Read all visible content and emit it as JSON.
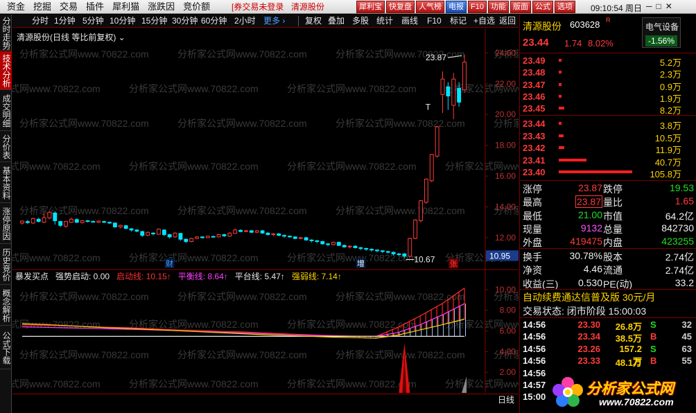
{
  "menu": {
    "items": [
      "资金",
      "挖掘",
      "交易",
      "插件",
      "犀利猫",
      "涨跌因",
      "竞价额"
    ],
    "broker_warning": "[券交易未登录",
    "stock": "清源股份",
    "buttons": [
      {
        "label": "犀利宝",
        "color": "red"
      },
      {
        "label": "快复盘",
        "color": "red"
      },
      {
        "label": "人气榜",
        "color": "red"
      },
      {
        "label": "电报",
        "color": "blue"
      },
      {
        "label": "F10",
        "color": "red"
      },
      {
        "label": "功能",
        "color": "red"
      },
      {
        "label": "版面",
        "color": "red"
      },
      {
        "label": "公式",
        "color": "red"
      },
      {
        "label": "选项",
        "color": "red"
      }
    ],
    "clock": "09:10:54 周日",
    "window_controls": [
      "─",
      "□",
      "✕"
    ]
  },
  "left_tabs": [
    {
      "label": "分时走势",
      "active": false
    },
    {
      "label": "技术分析",
      "active": true
    },
    {
      "label": "成交明细",
      "active": false
    },
    {
      "label": "分价表",
      "active": false
    },
    {
      "label": "基本资料",
      "active": false
    },
    {
      "label": "涨停原因",
      "active": false
    },
    {
      "label": "历史竞价",
      "active": false
    },
    {
      "label": "概念解析",
      "active": false
    },
    {
      "label": "公式下载",
      "active": false
    }
  ],
  "toolbar": {
    "periods": [
      "分时",
      "1分钟",
      "5分钟",
      "10分钟",
      "15分钟",
      "30分钟",
      "60分钟",
      "2小时"
    ],
    "more": "更多 ›",
    "tools": [
      "复权",
      "叠加",
      "多股",
      "统计",
      "画线",
      "F10",
      "标记",
      "+自选",
      "返回"
    ]
  },
  "chart_title": "清源股份(日线 等比前复权) ⌄",
  "watermark": "分析家公式网www.70822.com",
  "indicator_legend": {
    "name": "暴发买点",
    "items": [
      {
        "label": "强势启动: 0.00",
        "color": "#e8e8e8"
      },
      {
        "label": "启动线: 10.15↑",
        "color": "#ff3030"
      },
      {
        "label": "平衡线: 8.64↑",
        "color": "#ff40ff"
      },
      {
        "label": "平台线: 5.47↑",
        "color": "#e8e8e8"
      },
      {
        "label": "强弱线: 7.14↑",
        "color": "#ffd400"
      }
    ]
  },
  "chart_data": {
    "type": "candlestick",
    "ylim": [
      10.2,
      24.6
    ],
    "y_ticks": [
      "24.00",
      "22.00",
      "20.00",
      "18.00",
      "16.00",
      "14.00",
      "12.00"
    ],
    "current_price_label": "10.95",
    "annotations": {
      "high": "23.87",
      "low": "10.67",
      "t_mark": "T"
    },
    "event_markers": [
      {
        "label": "财",
        "index": 27
      },
      {
        "label": "增",
        "index": 62
      },
      {
        "label": "张",
        "index": 79
      }
    ],
    "candles": [
      [
        12.95,
        13.08,
        12.85,
        13.12
      ],
      [
        13.05,
        12.98,
        12.9,
        13.15
      ],
      [
        12.95,
        13.25,
        12.9,
        13.3
      ],
      [
        13.2,
        13.05,
        13.0,
        13.28
      ],
      [
        13.0,
        13.3,
        12.95,
        13.6
      ],
      [
        13.28,
        13.65,
        13.2,
        13.75
      ],
      [
        13.6,
        13.1,
        12.85,
        13.7
      ],
      [
        13.05,
        12.8,
        12.7,
        13.1
      ],
      [
        12.75,
        13.05,
        12.65,
        13.1
      ],
      [
        13.0,
        13.2,
        12.95,
        13.3
      ],
      [
        13.18,
        13.0,
        12.95,
        13.25
      ],
      [
        12.98,
        13.1,
        12.92,
        13.15
      ],
      [
        13.1,
        13.05,
        13.0,
        13.15
      ],
      [
        13.05,
        13.02,
        12.98,
        13.12
      ],
      [
        13.0,
        13.08,
        12.95,
        13.12
      ],
      [
        13.05,
        13.0,
        12.95,
        13.1
      ],
      [
        13.0,
        12.95,
        12.9,
        13.05
      ],
      [
        12.95,
        12.7,
        12.65,
        13.0
      ],
      [
        12.7,
        12.8,
        12.6,
        12.85
      ],
      [
        12.78,
        12.6,
        12.55,
        12.82
      ],
      [
        12.58,
        12.5,
        12.4,
        12.62
      ],
      [
        12.5,
        12.42,
        12.35,
        12.55
      ],
      [
        12.4,
        12.15,
        12.05,
        12.45
      ],
      [
        12.15,
        12.35,
        12.1,
        12.4
      ],
      [
        12.3,
        12.25,
        12.15,
        12.35
      ],
      [
        12.22,
        12.55,
        12.2,
        12.6
      ],
      [
        12.5,
        12.2,
        12.1,
        12.55
      ],
      [
        12.2,
        12.05,
        11.95,
        12.25
      ],
      [
        12.05,
        12.3,
        12.0,
        12.35
      ],
      [
        12.28,
        11.9,
        11.8,
        12.3
      ],
      [
        11.9,
        11.75,
        11.65,
        11.95
      ],
      [
        11.75,
        11.95,
        11.7,
        12.0
      ],
      [
        11.95,
        12.05,
        11.9,
        12.1
      ],
      [
        12.05,
        12.0,
        11.95,
        12.1
      ],
      [
        12.0,
        12.1,
        11.98,
        12.12
      ],
      [
        12.08,
        12.05,
        12.0,
        12.12
      ],
      [
        12.05,
        12.2,
        12.02,
        12.25
      ],
      [
        12.2,
        12.12,
        12.05,
        12.25
      ],
      [
        12.1,
        12.3,
        12.05,
        12.35
      ],
      [
        12.28,
        12.5,
        12.25,
        12.6
      ],
      [
        12.48,
        12.4,
        12.35,
        12.55
      ],
      [
        12.4,
        12.45,
        12.35,
        12.5
      ],
      [
        12.45,
        12.35,
        12.3,
        12.5
      ],
      [
        12.35,
        12.45,
        12.3,
        12.5
      ],
      [
        12.45,
        12.3,
        12.25,
        12.5
      ],
      [
        12.3,
        12.2,
        12.15,
        12.35
      ],
      [
        12.2,
        12.25,
        12.1,
        12.3
      ],
      [
        12.25,
        12.15,
        12.1,
        12.3
      ],
      [
        12.15,
        12.1,
        12.0,
        12.2
      ],
      [
        12.1,
        12.05,
        12.0,
        12.15
      ],
      [
        12.05,
        11.95,
        11.9,
        12.1
      ],
      [
        11.95,
        12.0,
        11.9,
        12.05
      ],
      [
        12.0,
        11.85,
        11.8,
        12.05
      ],
      [
        11.85,
        11.8,
        11.7,
        11.9
      ],
      [
        11.8,
        11.75,
        11.65,
        11.85
      ],
      [
        11.75,
        11.6,
        11.55,
        11.8
      ],
      [
        11.6,
        11.55,
        11.45,
        11.65
      ],
      [
        11.55,
        11.7,
        11.5,
        11.75
      ],
      [
        11.7,
        11.5,
        11.45,
        11.75
      ],
      [
        11.5,
        11.4,
        11.35,
        11.55
      ],
      [
        11.4,
        11.45,
        11.3,
        11.5
      ],
      [
        11.45,
        11.35,
        11.3,
        11.5
      ],
      [
        11.35,
        11.3,
        11.2,
        11.4
      ],
      [
        11.3,
        11.25,
        11.15,
        11.35
      ],
      [
        11.25,
        11.2,
        11.1,
        11.3
      ],
      [
        11.2,
        11.15,
        11.05,
        11.25
      ],
      [
        11.15,
        11.1,
        11.0,
        11.2
      ],
      [
        11.1,
        11.05,
        10.98,
        11.15
      ],
      [
        11.05,
        10.95,
        10.85,
        11.1
      ],
      [
        10.95,
        10.9,
        10.8,
        11.0
      ],
      [
        10.95,
        10.8,
        10.67,
        11.0
      ],
      [
        10.8,
        11.95,
        10.75,
        12.0
      ],
      [
        11.95,
        13.15,
        11.9,
        13.2
      ],
      [
        13.1,
        14.4,
        13.0,
        14.45
      ],
      [
        14.3,
        15.8,
        14.2,
        15.85
      ],
      [
        15.7,
        17.4,
        15.6,
        17.45
      ],
      [
        17.3,
        19.2,
        17.2,
        19.25
      ],
      [
        21.3,
        22.3,
        20.1,
        22.8
      ],
      [
        21.8,
        21.2,
        20.3,
        22.1
      ],
      [
        20.6,
        22.3,
        19.7,
        22.7
      ],
      [
        21.7,
        20.8,
        20.5,
        22.1
      ],
      [
        21.6,
        23.4,
        21.4,
        23.87
      ]
    ],
    "indicator": {
      "ylim": [
        0,
        11
      ],
      "y_ticks": [
        "10.00",
        "8.00",
        "6.00",
        "4.00",
        "2.00"
      ],
      "series": [
        {
          "name": "启动线",
          "values": [
            6.6,
            6.55,
            6.5,
            6.42,
            6.35,
            6.3,
            6.2,
            6.1,
            6.05,
            5.95,
            5.9,
            5.8,
            5.7,
            5.62,
            5.55,
            5.5,
            5.47,
            6.35,
            7.45,
            8.65,
            10.15
          ]
        },
        {
          "name": "平衡线",
          "values": [
            6.4,
            6.35,
            6.3,
            6.25,
            6.2,
            6.15,
            6.1,
            6.02,
            5.95,
            5.88,
            5.8,
            5.72,
            5.65,
            5.58,
            5.52,
            5.48,
            5.47,
            5.85,
            6.6,
            7.55,
            8.64
          ]
        },
        {
          "name": "平台线",
          "values": [
            5.47,
            5.47,
            5.47,
            5.47,
            5.47,
            5.47,
            5.47,
            5.47,
            5.47,
            5.47,
            5.47,
            5.47,
            5.47,
            5.47,
            5.47,
            5.47,
            5.47,
            5.47,
            5.47,
            5.47,
            5.47
          ]
        },
        {
          "name": "强弱线",
          "values": [
            6.7,
            6.62,
            6.52,
            6.4,
            6.3,
            6.22,
            6.12,
            6.02,
            5.92,
            5.82,
            5.72,
            5.62,
            5.55,
            5.48,
            5.4,
            5.35,
            5.3,
            5.6,
            6.1,
            6.6,
            7.14
          ]
        }
      ],
      "spike_index": 70,
      "spike_value": 4.8
    },
    "x_labels": [
      {
        "label": "2023年",
        "index": 0
      },
      {
        "label": "10",
        "index": 12
      },
      {
        "label": "11",
        "index": 33
      },
      {
        "label": "12",
        "index": 61
      },
      {
        "label": "1",
        "index": 78
      }
    ]
  },
  "period_label": "日线",
  "quote": {
    "name": "清源股份",
    "code": "603628",
    "r_mark": "R",
    "sector_name": "电气设备",
    "sector_change": "-1.56%",
    "price": "23.44",
    "change": "1.74",
    "change_pct": "8.02%",
    "asks": [
      {
        "price": "23.49",
        "volume": "5.2万",
        "ratio": 0.01
      },
      {
        "price": "23.48",
        "volume": "2.3万",
        "ratio": 0.01
      },
      {
        "price": "23.47",
        "volume": "0.9万",
        "ratio": 0.01
      },
      {
        "price": "23.46",
        "volume": "1.9万",
        "ratio": 0.01
      },
      {
        "price": "23.45",
        "volume": "8.2万",
        "ratio": 0.08
      }
    ],
    "bids": [
      {
        "price": "23.44",
        "volume": "3.8万",
        "ratio": 0.02
      },
      {
        "price": "23.43",
        "volume": "10.5万",
        "ratio": 0.07
      },
      {
        "price": "23.42",
        "volume": "11.9万",
        "ratio": 0.08
      },
      {
        "price": "23.41",
        "volume": "40.7万",
        "ratio": 0.38
      },
      {
        "price": "23.40",
        "volume": "105.8万",
        "ratio": 1.0
      }
    ],
    "stats": [
      {
        "l1": "涨停",
        "v1": "23.87",
        "c1": "red",
        "l2": "跌停",
        "v2": "19.53",
        "c2": "green"
      },
      {
        "l1": "最高",
        "v1": "23.87",
        "c1": "red boxed",
        "l2": "量比",
        "v2": "1.65",
        "c2": "red"
      },
      {
        "l1": "最低",
        "v1": "21.00",
        "c1": "green",
        "l2": "市值",
        "v2": "64.2亿",
        "c2": "white"
      },
      {
        "l1": "现量",
        "v1": "9132",
        "c1": "magenta",
        "l2": "总量",
        "v2": "842730",
        "c2": "white"
      },
      {
        "l1": "外盘",
        "v1": "419475",
        "c1": "red",
        "l2": "内盘",
        "v2": "423255",
        "c2": "green"
      },
      {
        "l1": "换手",
        "v1": "30.78%",
        "c1": "white",
        "l2": "股本",
        "v2": "2.74亿",
        "c2": "white"
      },
      {
        "l1": "净资",
        "v1": "4.46",
        "c1": "white",
        "l2": "流通",
        "v2": "2.74亿",
        "c2": "white"
      },
      {
        "l1": "收益(三)",
        "v1": "0.530",
        "c1": "white",
        "l2": "PE(动)",
        "v2": "33.2",
        "c2": "white"
      }
    ],
    "promo": "自动续费通达信普及版  30元/月",
    "trade_state": "交易状态: 闭市阶段 15:00:03",
    "ticks": [
      {
        "time": "14:56",
        "price": "23.30",
        "volume": "26.8万",
        "side": "S",
        "num": "32"
      },
      {
        "time": "14:56",
        "price": "23.34",
        "volume": "38.5万",
        "side": "B",
        "num": "45"
      },
      {
        "time": "14:56",
        "price": "23.26",
        "volume": "157.2万",
        "side": "S",
        "num": "63"
      },
      {
        "time": "14:56",
        "price": "23.33",
        "volume": "48.1万",
        "side": "B",
        "num": "55"
      },
      {
        "time": "14:56",
        "price": "",
        "volume": "",
        "side": "",
        "num": ""
      },
      {
        "time": "14:57",
        "price": "",
        "volume": "",
        "side": "",
        "num": ""
      },
      {
        "time": "15:00",
        "price": "",
        "volume": "",
        "side": "",
        "num": ""
      }
    ],
    "logo_text": "分析家公式网",
    "logo_url": "www.70822.com"
  }
}
